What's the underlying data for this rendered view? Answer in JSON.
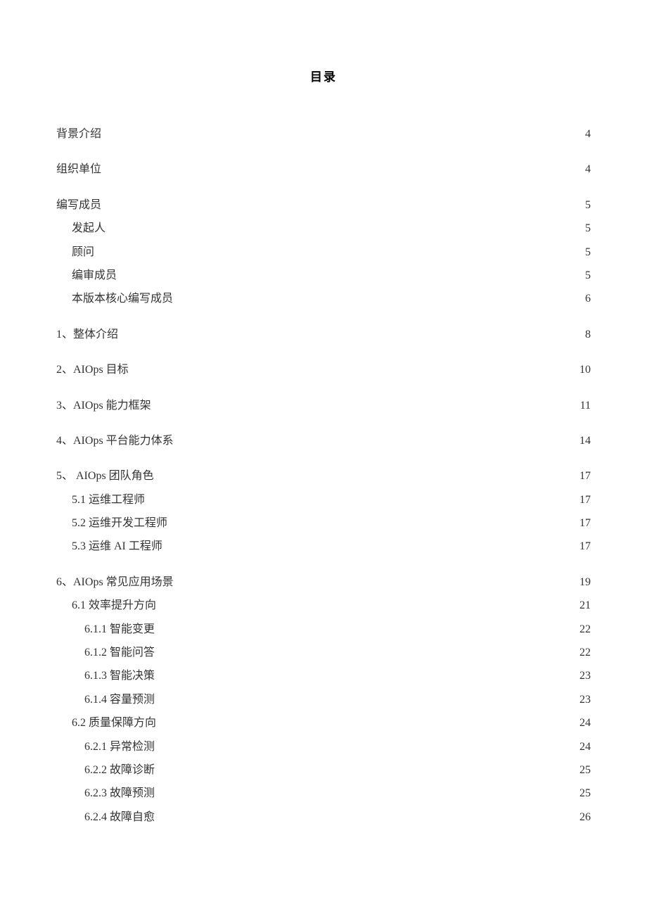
{
  "title": "目录",
  "toc": [
    {
      "label": "背景介绍",
      "page": "4",
      "level": 0
    },
    {
      "label": "组织单位",
      "page": "4",
      "level": 0
    },
    {
      "label": "编写成员",
      "page": "5",
      "level": 0
    },
    {
      "label": "发起人",
      "page": "5",
      "level": 1
    },
    {
      "label": "顾问",
      "page": "5",
      "level": 1
    },
    {
      "label": "编审成员",
      "page": "5",
      "level": 1
    },
    {
      "label": "本版本核心编写成员",
      "page": "6",
      "level": 1
    },
    {
      "label": "1、整体介绍",
      "page": "8",
      "level": 0
    },
    {
      "label": "2、AIOps 目标",
      "page": "10",
      "level": 0
    },
    {
      "label": "3、AIOps 能力框架",
      "page": "11",
      "level": 0
    },
    {
      "label": "4、AIOps 平台能力体系",
      "page": "14",
      "level": 0
    },
    {
      "label": "5、 AIOps 团队角色",
      "page": "17",
      "level": 0
    },
    {
      "label": "5.1 运维工程师",
      "page": "17",
      "level": 1
    },
    {
      "label": "5.2 运维开发工程师",
      "page": "17",
      "level": 1
    },
    {
      "label": "5.3 运维 AI 工程师",
      "page": "17",
      "level": 1
    },
    {
      "label": "6、AIOps 常见应用场景",
      "page": "19",
      "level": 0
    },
    {
      "label": "6.1 效率提升方向",
      "page": "21",
      "level": 1
    },
    {
      "label": "6.1.1 智能变更",
      "page": "22",
      "level": 2
    },
    {
      "label": "6.1.2 智能问答",
      "page": "22",
      "level": 2
    },
    {
      "label": "6.1.3 智能决策",
      "page": "23",
      "level": 2
    },
    {
      "label": "6.1.4 容量预测",
      "page": "23",
      "level": 2
    },
    {
      "label": "6.2 质量保障方向",
      "page": "24",
      "level": 1
    },
    {
      "label": "6.2.1 异常检测",
      "page": "24",
      "level": 2
    },
    {
      "label": "6.2.2 故障诊断",
      "page": "25",
      "level": 2
    },
    {
      "label": "6.2.3 故障预测",
      "page": "25",
      "level": 2
    },
    {
      "label": "6.2.4 故障自愈",
      "page": "26",
      "level": 2
    }
  ]
}
